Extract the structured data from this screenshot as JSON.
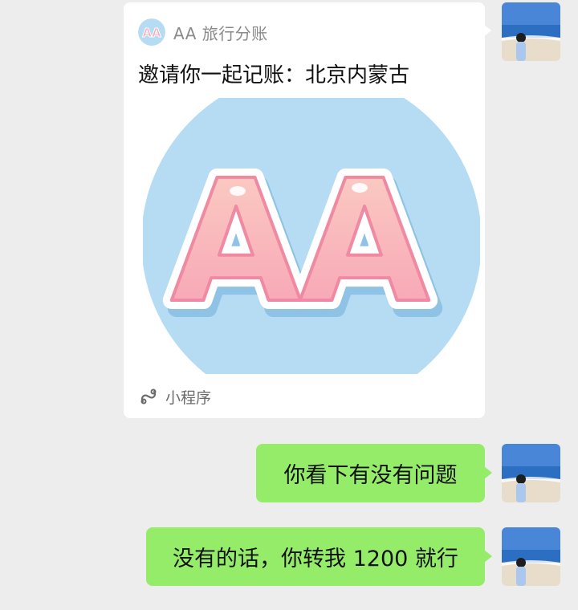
{
  "colors": {
    "background": "#ededed",
    "card_bg": "#ffffff",
    "bubble_green": "#95ec69",
    "logo_circle": "#b6dcf3",
    "logo_letters": "#f7aab8"
  },
  "card": {
    "app_icon": "aa-logo-icon",
    "app_name": "AA 旅行分账",
    "title": "邀请你一起记账：北京内蒙古",
    "image": "aa-logo-image",
    "footer_icon": "mini-program-icon",
    "footer_label": "小程序"
  },
  "messages": [
    {
      "text": "你看下有没有问题"
    },
    {
      "text": "没有的话，你转我 1200 就行"
    }
  ]
}
